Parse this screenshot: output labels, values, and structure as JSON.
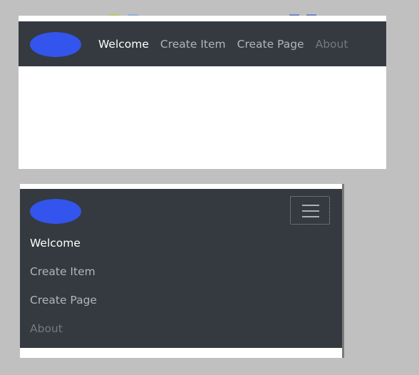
{
  "nav": {
    "links": [
      {
        "label": "Welcome",
        "state": "active"
      },
      {
        "label": "Create Item",
        "state": "normal"
      },
      {
        "label": "Create Page",
        "state": "normal"
      },
      {
        "label": "About",
        "state": "disabled"
      }
    ]
  },
  "colors": {
    "page_background": "#c0c0c0",
    "navbar_background": "#343a40",
    "brand_logo": "#3355ee",
    "content_background": "#ffffff"
  },
  "icons": {
    "brand": "brand-logo-oval",
    "toggler": "hamburger-menu-icon"
  }
}
